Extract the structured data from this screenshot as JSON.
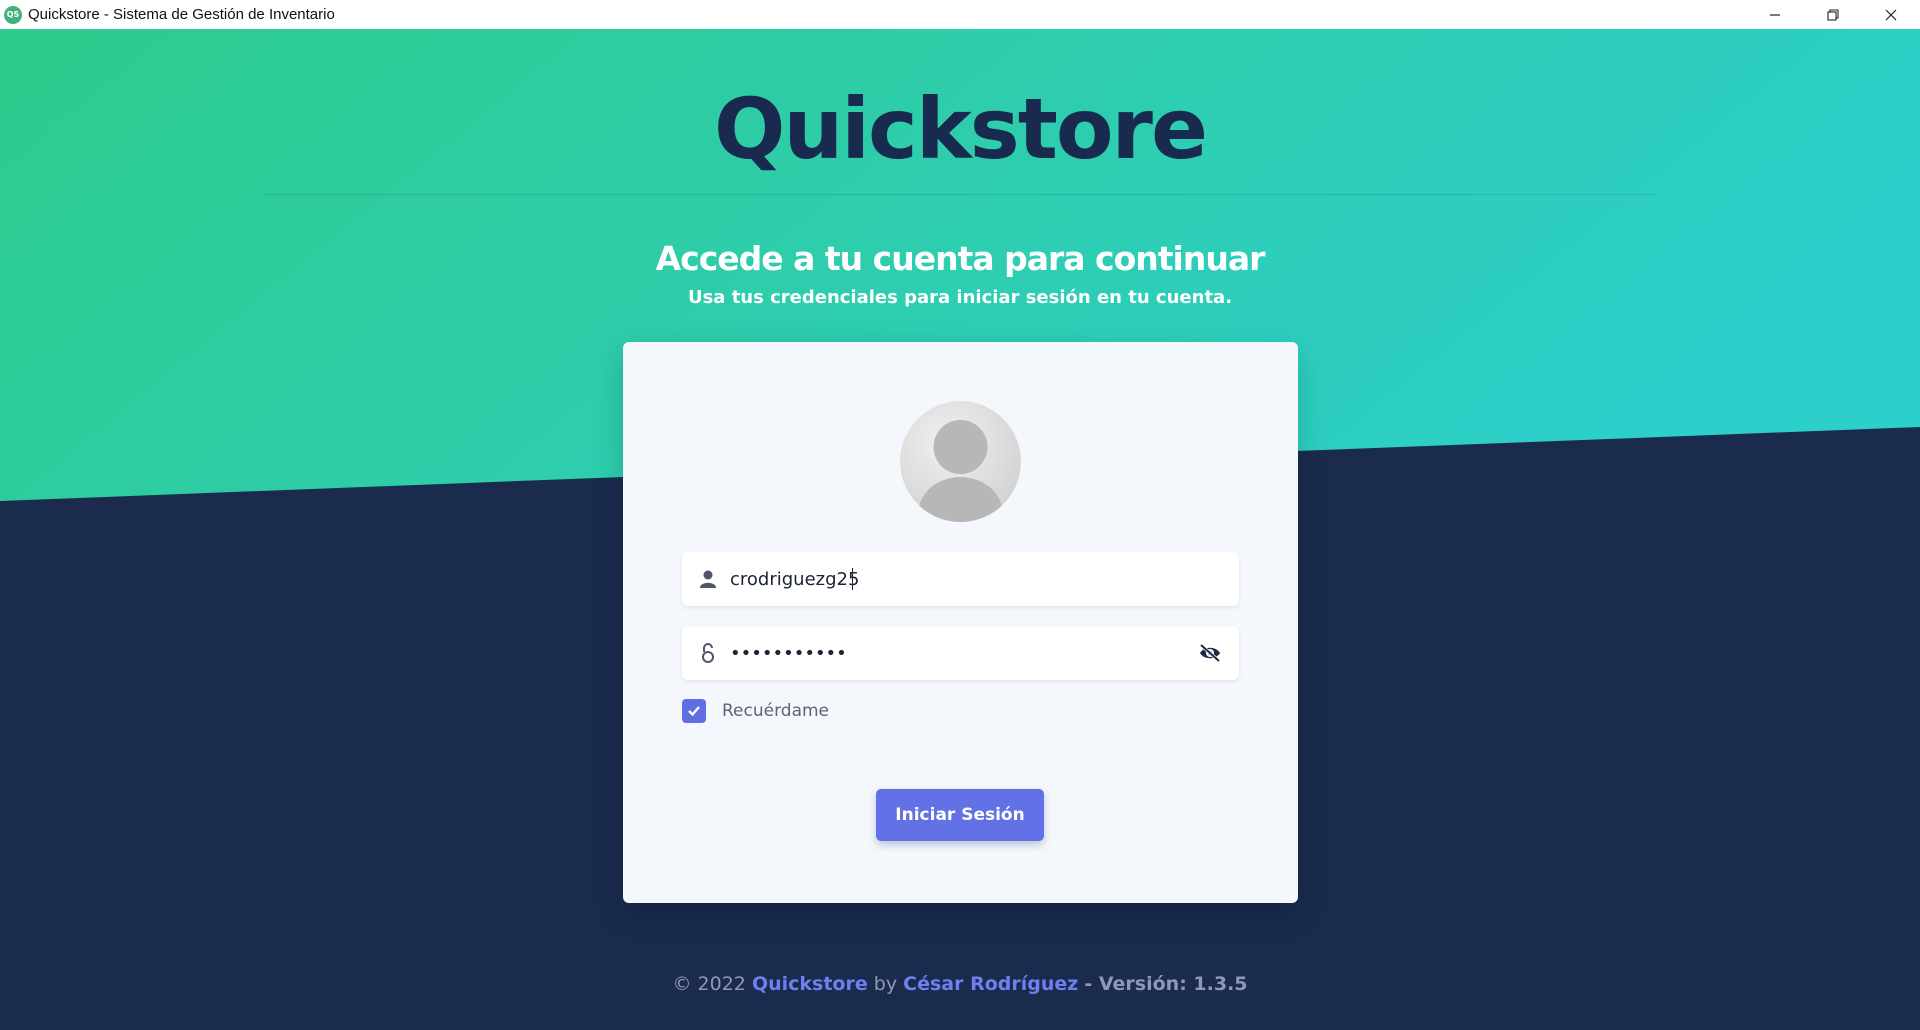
{
  "window": {
    "app_icon_text": "QS",
    "title": "Quickstore - Sistema de Gestión de Inventario",
    "controls": [
      "minimize",
      "restore",
      "close"
    ]
  },
  "colors": {
    "gradient_start": "#2ecb8c",
    "gradient_end": "#2dcfca",
    "background_dark": "#1a2b4d",
    "brand_text": "#182a4e",
    "primary_button": "#6271e6",
    "link": "#6f7ff0"
  },
  "header": {
    "brand": "Quickstore",
    "heading": "Accede a tu cuenta para continuar",
    "subheading": "Usa tus credenciales para iniciar sesión en tu cuenta."
  },
  "login": {
    "avatar_icon": "user-avatar",
    "username": {
      "icon": "user-icon",
      "value": "crodriguezg25"
    },
    "password": {
      "icon": "lock-icon",
      "value": "•••••••••••",
      "toggle_icon": "eye-slash-icon"
    },
    "remember": {
      "checked": true,
      "label": "Recuérdame"
    },
    "submit_label": "Iniciar Sesión"
  },
  "footer": {
    "copyright": "© 2022",
    "app_link": "Quickstore",
    "by": "by",
    "author_link": "César Rodríguez",
    "version": "- Versión: 1.3.5"
  }
}
